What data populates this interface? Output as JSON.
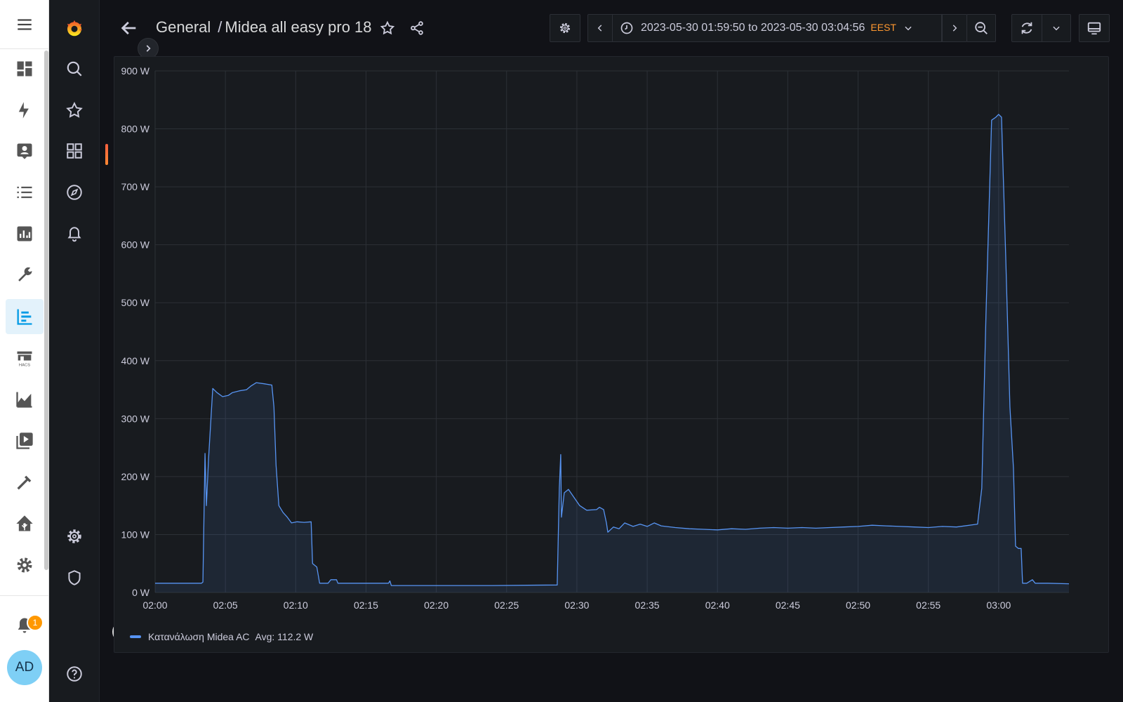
{
  "ha_sidebar": {
    "items": [
      {
        "icon": "menu-icon"
      },
      {
        "icon": "dashboard-icon"
      },
      {
        "icon": "energy-icon"
      },
      {
        "icon": "map-icon"
      },
      {
        "icon": "logbook-icon"
      },
      {
        "icon": "history-icon"
      },
      {
        "icon": "wrench-icon"
      },
      {
        "icon": "grafana-icon",
        "active": true
      },
      {
        "icon": "hacs-icon"
      },
      {
        "icon": "chart-line-icon"
      },
      {
        "icon": "media-icon"
      },
      {
        "icon": "hammer-icon"
      },
      {
        "icon": "home-assistant-icon"
      },
      {
        "icon": "settings-icon"
      }
    ],
    "notifications_count": "1",
    "user_initials": "AD"
  },
  "grafana_sidebar": {
    "items": [
      "search-icon",
      "star-icon",
      "dashboards-icon",
      "explore-icon",
      "alerting-icon",
      "configuration-icon",
      "shield-icon",
      "user-avatar",
      "help-icon"
    ]
  },
  "topbar": {
    "breadcrumb_folder": "General",
    "breadcrumb_separator": "/",
    "dashboard_title": "Midea all easy pro 18",
    "time_from": "2023-05-30 01:59:50",
    "time_to_word": "to",
    "time_to": "2023-05-30 03:04:56",
    "timezone": "EEST"
  },
  "colors": {
    "series": "#5794f2",
    "timezone": "#ff9830",
    "active_accent": "#f55f3e"
  },
  "chart_data": {
    "type": "area",
    "ylim": [
      0,
      900
    ],
    "y_ticks": [
      0,
      100,
      200,
      300,
      400,
      500,
      600,
      700,
      800,
      900
    ],
    "y_unit": "W",
    "x_range_minutes": [
      0,
      65
    ],
    "x_ticks": [
      "02:00",
      "02:05",
      "02:10",
      "02:15",
      "02:20",
      "02:25",
      "02:30",
      "02:35",
      "02:40",
      "02:45",
      "02:50",
      "02:55",
      "03:00"
    ],
    "series": [
      {
        "name": "Κατανάλωση Midea AC",
        "avg_label": "Avg: 112.2 W",
        "points": [
          [
            0,
            16
          ],
          [
            3.3,
            16
          ],
          [
            3.4,
            18
          ],
          [
            3.55,
            240
          ],
          [
            3.65,
            150
          ],
          [
            3.8,
            230
          ],
          [
            4.1,
            352
          ],
          [
            4.4,
            345
          ],
          [
            4.8,
            338
          ],
          [
            5.2,
            340
          ],
          [
            5.5,
            345
          ],
          [
            6,
            348
          ],
          [
            6.5,
            350
          ],
          [
            6.8,
            356
          ],
          [
            7.2,
            362
          ],
          [
            7.8,
            360
          ],
          [
            8.3,
            358
          ],
          [
            8.45,
            320
          ],
          [
            8.6,
            220
          ],
          [
            8.8,
            150
          ],
          [
            9.1,
            138
          ],
          [
            9.4,
            130
          ],
          [
            9.7,
            120
          ],
          [
            10.1,
            122
          ],
          [
            10.6,
            121
          ],
          [
            11.1,
            122
          ],
          [
            11.2,
            50
          ],
          [
            11.5,
            44
          ],
          [
            11.7,
            16
          ],
          [
            12.3,
            16
          ],
          [
            12.5,
            22
          ],
          [
            12.9,
            22
          ],
          [
            13,
            16
          ],
          [
            15,
            16
          ],
          [
            16.6,
            16
          ],
          [
            16.7,
            20
          ],
          [
            16.8,
            12
          ],
          [
            20,
            12
          ],
          [
            24,
            12
          ],
          [
            28.6,
            13
          ],
          [
            28.75,
            180
          ],
          [
            28.85,
            238
          ],
          [
            28.9,
            130
          ],
          [
            29.1,
            172
          ],
          [
            29.4,
            178
          ],
          [
            30.2,
            150
          ],
          [
            30.7,
            142
          ],
          [
            31.4,
            143
          ],
          [
            31.6,
            147
          ],
          [
            31.9,
            143
          ],
          [
            32.1,
            120
          ],
          [
            32.2,
            104
          ],
          [
            32.6,
            113
          ],
          [
            33,
            110
          ],
          [
            33.4,
            120
          ],
          [
            34,
            114
          ],
          [
            34.5,
            118
          ],
          [
            35,
            114
          ],
          [
            35.5,
            120
          ],
          [
            36,
            115
          ],
          [
            37,
            112
          ],
          [
            38,
            110
          ],
          [
            39,
            109
          ],
          [
            40,
            108
          ],
          [
            41,
            110
          ],
          [
            42,
            109
          ],
          [
            43,
            111
          ],
          [
            44,
            112
          ],
          [
            45,
            111
          ],
          [
            46,
            112
          ],
          [
            47,
            111
          ],
          [
            48,
            112
          ],
          [
            49,
            113
          ],
          [
            50,
            114
          ],
          [
            51,
            116
          ],
          [
            52,
            115
          ],
          [
            53,
            114
          ],
          [
            54,
            113
          ],
          [
            55,
            112
          ],
          [
            56,
            114
          ],
          [
            57,
            113
          ],
          [
            58.5,
            118
          ],
          [
            58.8,
            180
          ],
          [
            59.1,
            480
          ],
          [
            59.5,
            815
          ],
          [
            59.8,
            820
          ],
          [
            60,
            825
          ],
          [
            60.2,
            820
          ],
          [
            60.5,
            580
          ],
          [
            60.8,
            320
          ],
          [
            61.05,
            215
          ],
          [
            61.2,
            80
          ],
          [
            61.4,
            76
          ],
          [
            61.6,
            76
          ],
          [
            61.7,
            16
          ],
          [
            62,
            16
          ],
          [
            62.4,
            22
          ],
          [
            62.6,
            16
          ],
          [
            63.5,
            16
          ],
          [
            65,
            15
          ]
        ]
      }
    ]
  }
}
